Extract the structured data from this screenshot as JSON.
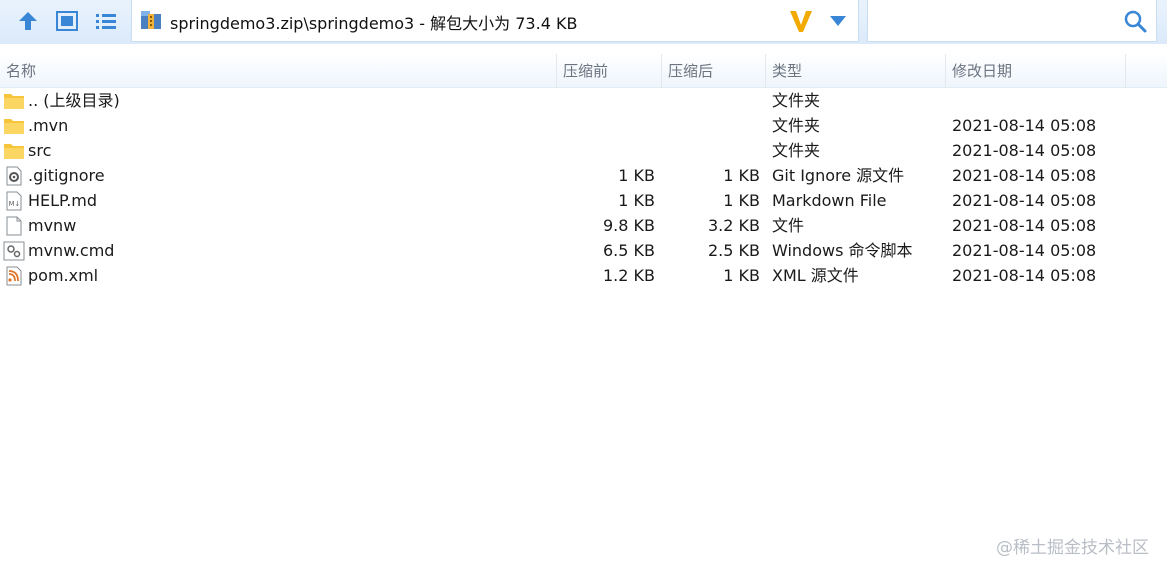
{
  "toolbar": {
    "up_icon": "arrow-up-icon",
    "view_icon": "thumbnail-view-icon",
    "list_icon": "list-view-icon"
  },
  "path": {
    "text": "springdemo3.zip\\springdemo3 - 解包大小为 73.4 KB",
    "archive_icon": "zip-archive-icon",
    "logo_icon": "v-logo-icon",
    "dropdown_icon": "chevron-down-icon"
  },
  "search": {
    "placeholder": "",
    "value": "",
    "icon": "search-icon"
  },
  "columns": {
    "name": "名称",
    "size": "压缩前",
    "packed": "压缩后",
    "type": "类型",
    "modified": "修改日期"
  },
  "files": [
    {
      "name": ".. (上级目录)",
      "size": "",
      "packed": "",
      "type": "文件夹",
      "modified": "",
      "icon": "folder-icon"
    },
    {
      "name": ".mvn",
      "size": "",
      "packed": "",
      "type": "文件夹",
      "modified": "2021-08-14 05:08",
      "icon": "folder-icon"
    },
    {
      "name": "src",
      "size": "",
      "packed": "",
      "type": "文件夹",
      "modified": "2021-08-14 05:08",
      "icon": "folder-icon"
    },
    {
      "name": ".gitignore",
      "size": "1 KB",
      "packed": "1 KB",
      "type": "Git Ignore 源文件",
      "modified": "2021-08-14 05:08",
      "icon": "gear-file-icon"
    },
    {
      "name": "HELP.md",
      "size": "1 KB",
      "packed": "1 KB",
      "type": "Markdown File",
      "modified": "2021-08-14 05:08",
      "icon": "markdown-file-icon"
    },
    {
      "name": "mvnw",
      "size": "9.8 KB",
      "packed": "3.2 KB",
      "type": "文件",
      "modified": "2021-08-14 05:08",
      "icon": "blank-file-icon"
    },
    {
      "name": "mvnw.cmd",
      "size": "6.5 KB",
      "packed": "2.5 KB",
      "type": "Windows 命令脚本",
      "modified": "2021-08-14 05:08",
      "icon": "script-file-icon"
    },
    {
      "name": "pom.xml",
      "size": "1.2 KB",
      "packed": "1 KB",
      "type": "XML 源文件",
      "modified": "2021-08-14 05:08",
      "icon": "xml-file-icon"
    }
  ],
  "watermark": "@稀土掘金技术社区",
  "colors": {
    "accent": "#3a86d6",
    "toolbar_bg": "#dbeafa",
    "folder": "#f7c53b",
    "logo": "#f2a900"
  }
}
